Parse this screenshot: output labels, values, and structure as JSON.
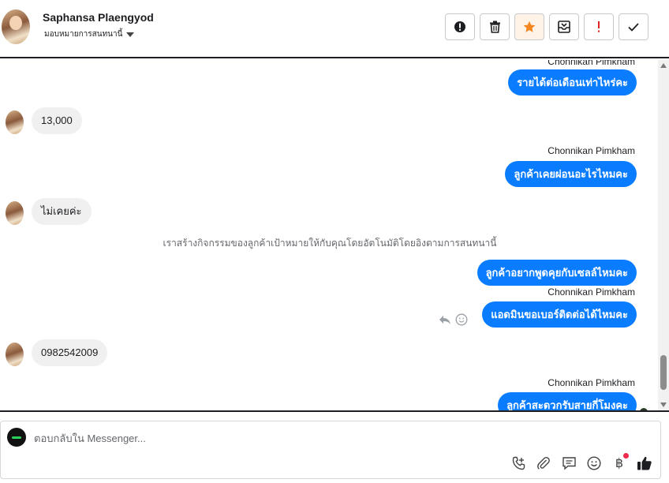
{
  "header": {
    "contact_name": "Saphansa Plaengyod",
    "assign_label": "มอบหมายการสนทนานี้"
  },
  "actions": [
    {
      "name": "mark-spam-button",
      "icon": "alert-circle-icon"
    },
    {
      "name": "delete-button",
      "icon": "trash-icon"
    },
    {
      "name": "star-button",
      "icon": "star-icon"
    },
    {
      "name": "archive-button",
      "icon": "archive-icon"
    },
    {
      "name": "follow-up-button",
      "icon": "exclamation-icon"
    },
    {
      "name": "mark-done-button",
      "icon": "check-icon"
    }
  ],
  "messages": {
    "m1_sender": "Chonnikan Pimkham",
    "m1_text": "รายได้ต่อเดือนเท่าไหร่คะ",
    "m2_text": "13,000",
    "m3_sender": "Chonnikan Pimkham",
    "m3_text": "ลูกค้าเคยผ่อนอะไรไหมคะ",
    "m4_text": "ไม่เคยค่ะ",
    "system_note": "เราสร้างกิจกรรมของลูกค้าเป้าหมายให้กับคุณโดยอัตโนมัติโดยอิงตามการสนทนานี้",
    "m5_text": "ลูกค้าอยากพูดคุยกับเซลล์ไหมคะ",
    "m6_sender": "Chonnikan Pimkham",
    "m6_text": "แอดมินขอเบอร์ติดต่อได้ไหมคะ",
    "m7_text": "0982542009",
    "m8_sender": "Chonnikan Pimkham",
    "m8_text": "ลูกค้าสะดวกรับสายกี่โมงคะ"
  },
  "composer": {
    "placeholder": "ตอบกลับใน Messenger..."
  },
  "colors": {
    "outgoing_bubble": "#0a7cff",
    "incoming_bubble": "#f0f0f0",
    "star": "#f5861f",
    "follow_up": "#e02424",
    "notification_dot": "#f0284a"
  },
  "tools": [
    "call-icon",
    "attachment-icon",
    "saved-replies-icon",
    "emoji-icon",
    "baht-payment-icon",
    "thumbs-up-icon"
  ]
}
